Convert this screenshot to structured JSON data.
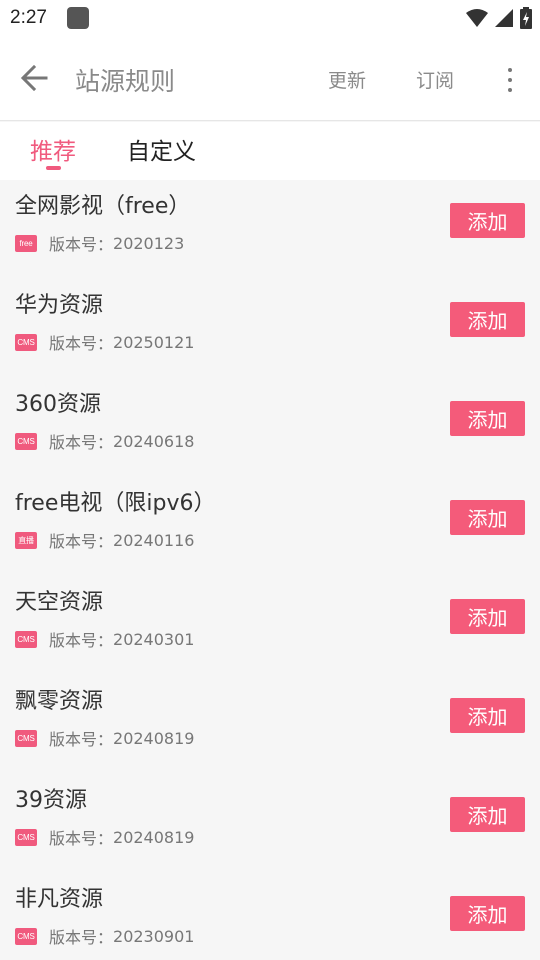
{
  "status_bar": {
    "time": "2:27"
  },
  "app_bar": {
    "title": "站源规则",
    "update_label": "更新",
    "subscribe_label": "订阅"
  },
  "tabs": [
    {
      "label": "推荐",
      "active": true
    },
    {
      "label": "自定义",
      "active": false
    }
  ],
  "colors": {
    "accent": "#f05a7e",
    "button": "#f45b7a"
  },
  "sources": [
    {
      "name": "全网影视（free）",
      "badge": "free",
      "version_label": "版本号：",
      "version": "2020123",
      "action": "添加"
    },
    {
      "name": "华为资源",
      "badge": "CMS",
      "version_label": "版本号：",
      "version": "20250121",
      "action": "添加"
    },
    {
      "name": "360资源",
      "badge": "CMS",
      "version_label": "版本号：",
      "version": "20240618",
      "action": "添加"
    },
    {
      "name": "free电视（限ipv6）",
      "badge": "直播",
      "version_label": "版本号：",
      "version": "20240116",
      "action": "添加"
    },
    {
      "name": "天空资源",
      "badge": "CMS",
      "version_label": "版本号：",
      "version": "20240301",
      "action": "添加"
    },
    {
      "name": "飘零资源",
      "badge": "CMS",
      "version_label": "版本号：",
      "version": "20240819",
      "action": "添加"
    },
    {
      "name": "39资源",
      "badge": "CMS",
      "version_label": "版本号：",
      "version": "20240819",
      "action": "添加"
    },
    {
      "name": "非凡资源",
      "badge": "CMS",
      "version_label": "版本号：",
      "version": "20230901",
      "action": "添加"
    }
  ]
}
